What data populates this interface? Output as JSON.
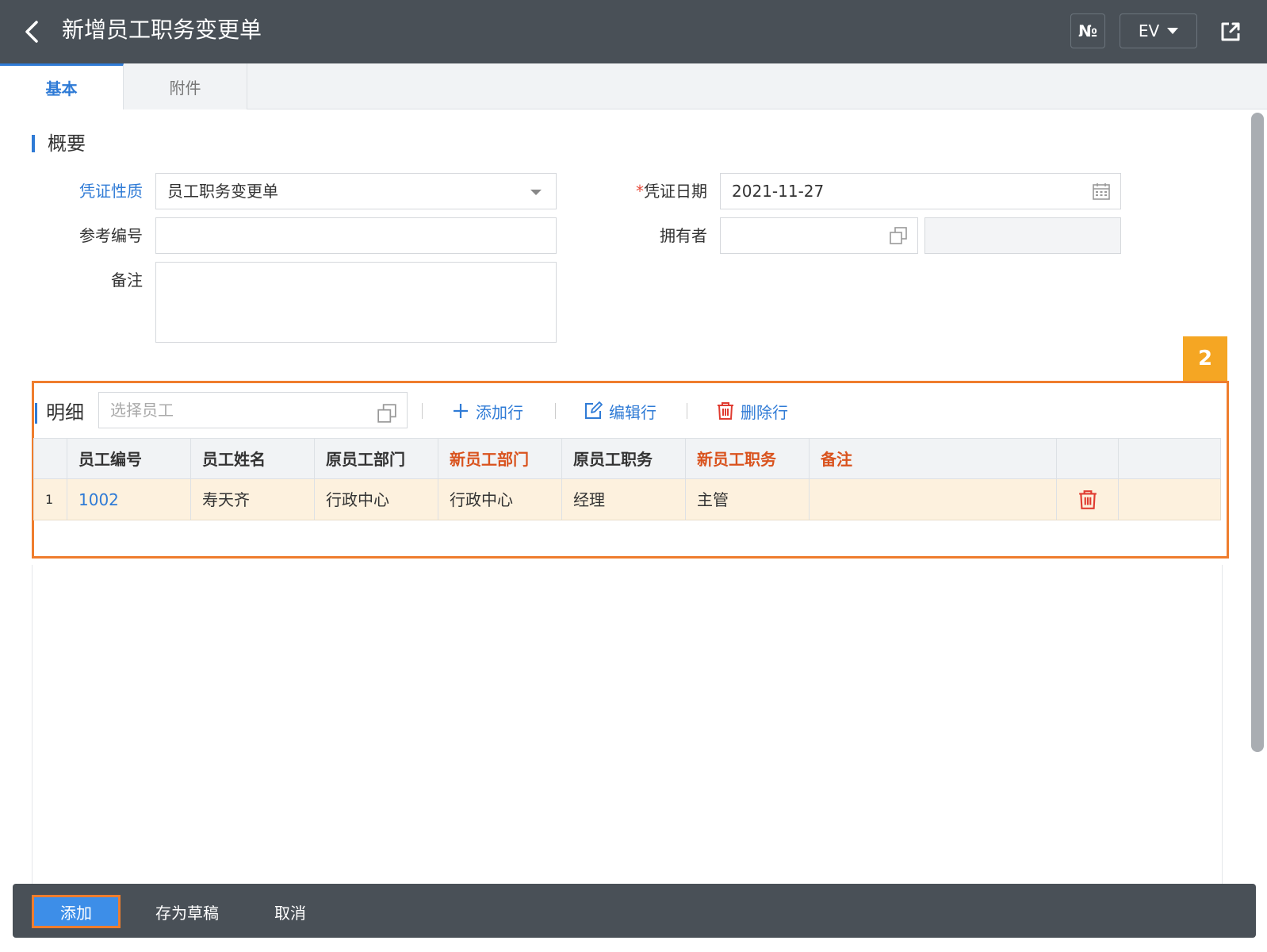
{
  "header": {
    "title": "新增员工职务变更单",
    "no_label": "№",
    "lang_label": "EV"
  },
  "tabs": [
    {
      "label": "基本",
      "active": true
    },
    {
      "label": "附件",
      "active": false
    }
  ],
  "overview": {
    "section_title": "概要",
    "voucher_type_label": "凭证性质",
    "voucher_type_value": "员工职务变更单",
    "voucher_date_required": "*",
    "voucher_date_label": "凭证日期",
    "voucher_date_value": "2021-11-27",
    "ref_no_label": "参考编号",
    "ref_no_value": "",
    "owner_label": "拥有者",
    "owner_value": "",
    "owner_name_value": "",
    "remark_label": "备注",
    "remark_value": ""
  },
  "badge": "2",
  "detail": {
    "label": "明细",
    "employee_placeholder": "选择员工",
    "add_row": "添加行",
    "edit_row": "编辑行",
    "delete_row": "删除行",
    "columns": [
      "员工编号",
      "员工姓名",
      "原员工部门",
      "新员工部门",
      "原员工职务",
      "新员工职务",
      "备注"
    ],
    "rows": [
      {
        "no": "1",
        "emp_id": "1002",
        "emp_name": "寿天齐",
        "old_dept": "行政中心",
        "new_dept": "行政中心",
        "old_title": "经理",
        "new_title": "主管",
        "remark": ""
      }
    ]
  },
  "footer": {
    "add": "添加",
    "save_draft": "存为草稿",
    "cancel": "取消"
  },
  "colors": {
    "topbar": "#495057",
    "accent": "#2f7bd6",
    "highlight": "#ef7d2d",
    "badge": "#f5a623",
    "required_col": "#d9531e",
    "row_selected": "#fdf1de"
  }
}
